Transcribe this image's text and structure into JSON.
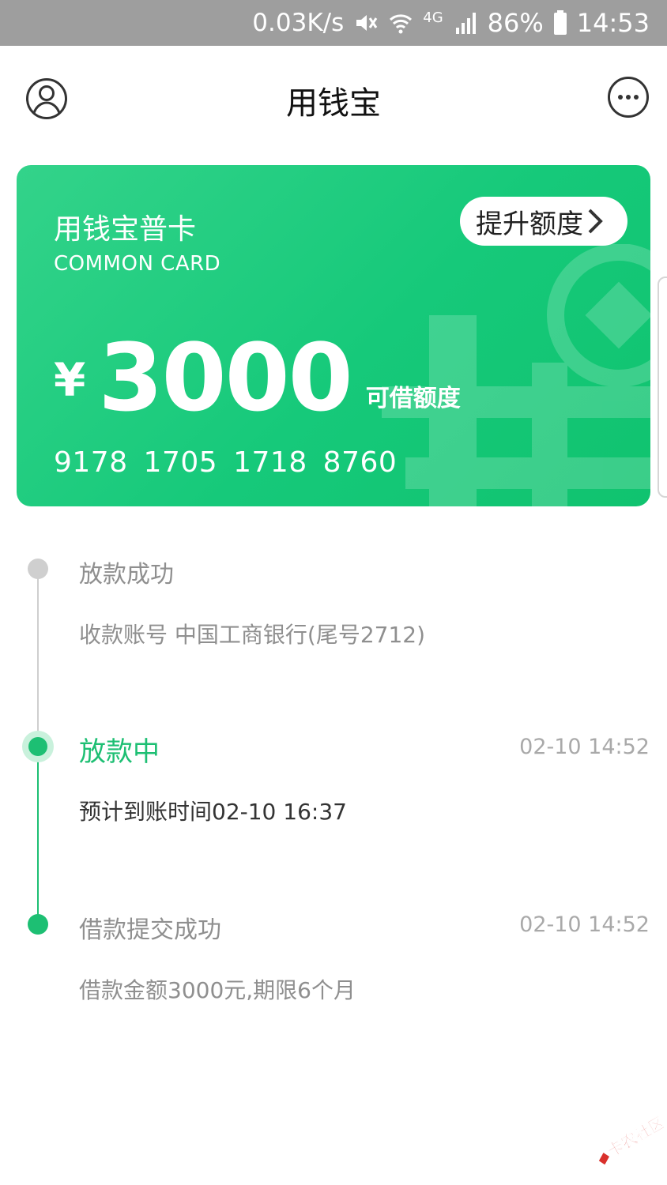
{
  "status_bar": {
    "net_speed": "0.03K/s",
    "network": "4G",
    "battery": "86%",
    "time": "14:53"
  },
  "header": {
    "title": "用钱宝",
    "left_icon": "user-icon",
    "right_icon": "more-icon"
  },
  "card": {
    "title": "用钱宝普卡",
    "subtitle": "COMMON CARD",
    "raise_button": "提升额度",
    "currency": "¥",
    "amount": "3000",
    "amount_label": "可借额度",
    "number": "9178 1705 1718 8760"
  },
  "timeline": [
    {
      "title": "放款成功",
      "desc": "收款账号 中国工商银行(尾号2712)",
      "time": ""
    },
    {
      "title": "放款中",
      "desc": "预计到账时间02-10 16:37",
      "time": "02-10 14:52"
    },
    {
      "title": "借款提交成功",
      "desc": "借款金额3000元,期限6个月",
      "time": "02-10 14:52"
    }
  ],
  "colors": {
    "accent": "#1dbf73",
    "card_gradient_start": "#33d38a",
    "card_gradient_end": "#10c36f",
    "status_bar": "#9e9e9e"
  },
  "watermark_logo": "卡农社区"
}
